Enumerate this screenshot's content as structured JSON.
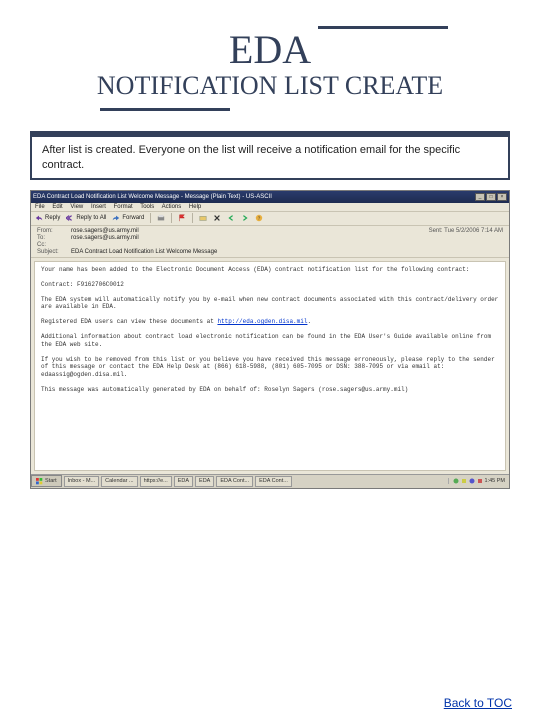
{
  "title": {
    "main": "EDA",
    "sub": "NOTIFICATION LIST CREATE"
  },
  "caption": "After list is created.  Everyone on the list will receive a notification email for the specific contract.",
  "email": {
    "window_title": "EDA Contract Load Notification List Welcome Message - Message (Plain Text) - US-ASCII",
    "menubar": [
      "File",
      "Edit",
      "View",
      "Insert",
      "Format",
      "Tools",
      "Actions",
      "Help"
    ],
    "toolbar": {
      "reply": "Reply",
      "reply_all": "Reply to All",
      "forward": "Forward"
    },
    "sent_label": "Sent:",
    "sent_value": "Tue 5/2/2006 7:14 AM",
    "from_label": "From:",
    "from_value": "rose.sagers@us.army.mil",
    "to_label": "To:",
    "to_value": "rose.sagers@us.army.mil",
    "cc_label": "Cc:",
    "cc_value": "",
    "subject_label": "Subject:",
    "subject_value": "EDA Contract Load Notification List Welcome Message",
    "body_line1": "Your name has been added to the Electronic Document Access (EDA) contract notification list for the following contract:",
    "body_line2": "Contract: F9162706C0012",
    "body_line3": "The EDA system will automatically notify you by e-mail when new contract documents associated with this contract/delivery order are available in EDA.",
    "body_line4_pre": "Registered EDA users can view these documents at ",
    "body_link": "http://eda.ogden.disa.mil",
    "body_line4_post": ".",
    "body_line5": "Additional information about contract load electronic notification can be found in the EDA User's Guide available online from the EDA web site.",
    "body_line6": "If you wish to be removed from this list or you believe you have received this message erroneously, please reply to the sender of this message or contact the EDA Help Desk at (866) 618-5988, (801) 605-7095 or DSN: 388-7095 or via email at: edaassig@ogden.disa.mil.",
    "body_line7": "This message was automatically generated by EDA on behalf of: Roselyn Sagers (rose.sagers@us.army.mil)"
  },
  "taskbar": {
    "start": "Start",
    "items": [
      "Inbox - M...",
      "Calendar ...",
      "https://e...",
      "EDA",
      "EDA",
      "EDA Cont...",
      "EDA Cont..."
    ],
    "time": "1:45 PM"
  },
  "back_link": "Back to TOC"
}
